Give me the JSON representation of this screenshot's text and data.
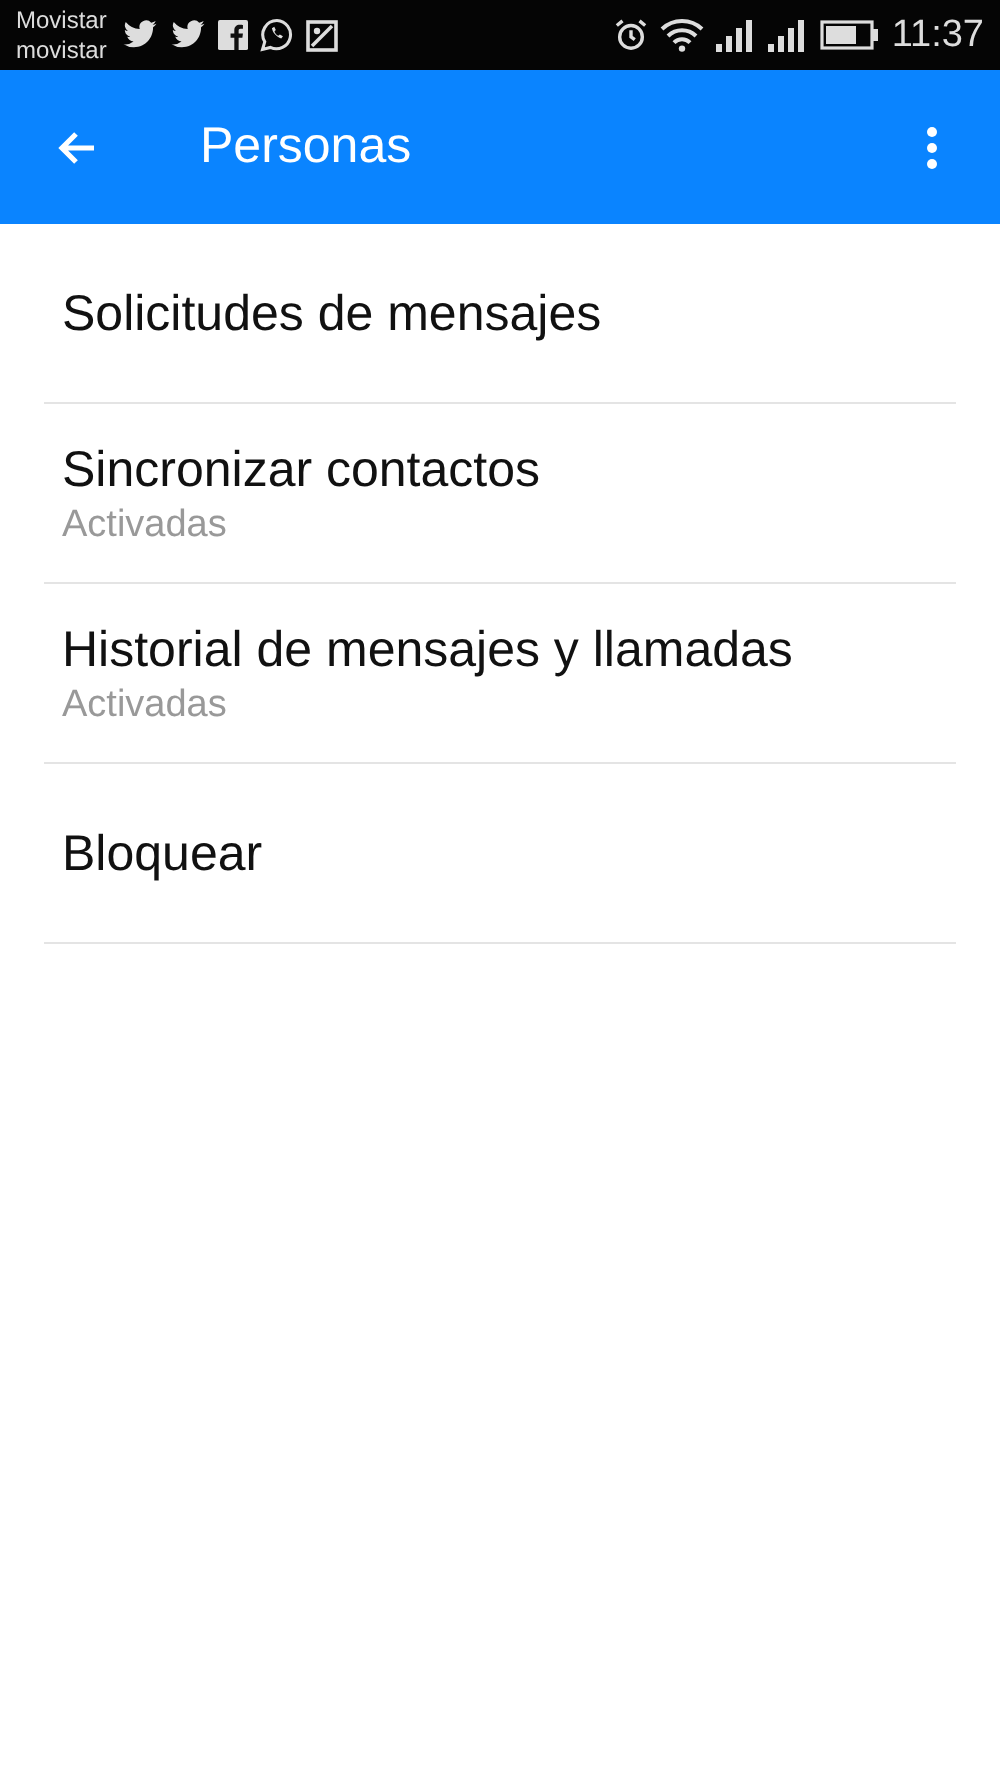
{
  "status_bar": {
    "carriers": [
      "Movistar",
      "movistar"
    ],
    "time": "11:37"
  },
  "app_bar": {
    "title": "Personas"
  },
  "items": [
    {
      "title": "Solicitudes de mensajes"
    },
    {
      "title": "Sincronizar contactos",
      "subtitle": "Activadas"
    },
    {
      "title": "Historial de mensajes y llamadas",
      "subtitle": "Activadas"
    },
    {
      "title": "Bloquear"
    }
  ]
}
